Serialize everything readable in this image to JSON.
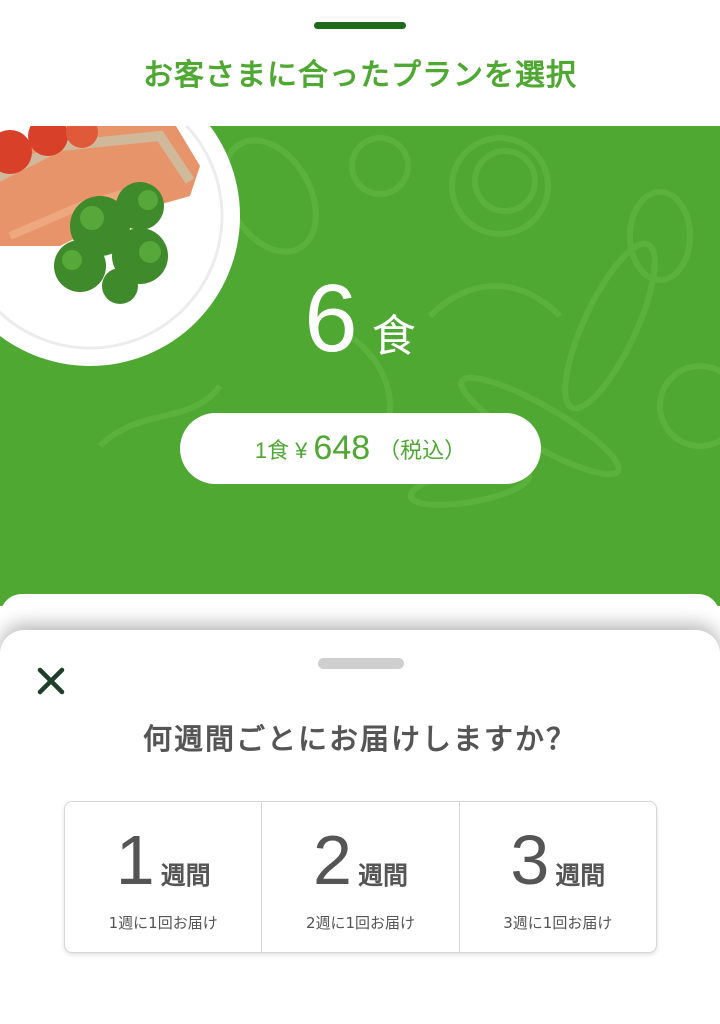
{
  "header": {
    "title": "お客さまに合ったプランを選択"
  },
  "plan": {
    "count": "6",
    "unit": "食",
    "price_prefix": "1食 ¥",
    "price_amount": "648",
    "price_suffix": "（税込）"
  },
  "sheet": {
    "question": "何週間ごとにお届けしますか？",
    "options": [
      {
        "number": "1",
        "unit": "週間",
        "description": "1週に1回お届け"
      },
      {
        "number": "2",
        "unit": "週間",
        "description": "2週に1回お届け"
      },
      {
        "number": "3",
        "unit": "週間",
        "description": "3週に1回お届け"
      }
    ]
  },
  "colors": {
    "brand_green": "#4ea832",
    "dark_green": "#1f6a1f",
    "text_gray": "#555555"
  },
  "icons": {
    "close": "close-icon"
  }
}
